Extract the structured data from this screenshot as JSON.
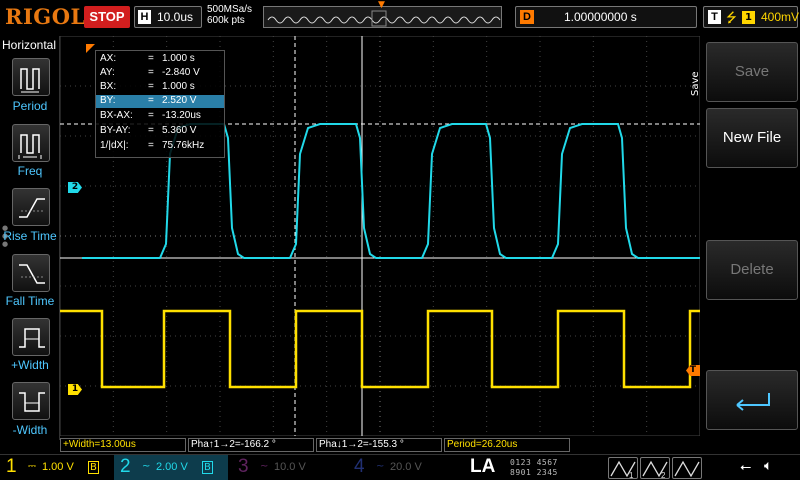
{
  "topbar": {
    "brand": "RIGOL",
    "run_state": "STOP",
    "timebase_tag": "H",
    "timebase": "10.0us",
    "sample_rate": "500MSa/s",
    "mem_depth": "600k pts",
    "delay_tag": "D",
    "delay": "1.00000000 s",
    "trigger_tag": "T",
    "trigger_source": "1",
    "trigger_level": "400mV"
  },
  "left_panel": {
    "title": "Horizontal",
    "items": [
      {
        "label": "Period",
        "icon": "period-icon"
      },
      {
        "label": "Freq",
        "icon": "frequency-icon"
      },
      {
        "label": "Rise Time",
        "icon": "rise-time-icon"
      },
      {
        "label": "Fall Time",
        "icon": "fall-time-icon"
      },
      {
        "label": "+Width",
        "icon": "positive-width-icon"
      },
      {
        "label": "-Width",
        "icon": "negative-width-icon"
      }
    ]
  },
  "cursor_readout": [
    {
      "key": "AX:",
      "value": "1.000 s"
    },
    {
      "key": "AY:",
      "value": "-2.840 V"
    },
    {
      "key": "BX:",
      "value": "1.000 s"
    },
    {
      "key": "BY:",
      "value": "2.520 V"
    },
    {
      "key": "BX-AX:",
      "value": "-13.20us"
    },
    {
      "key": "BY-AY:",
      "value": "5.360 V"
    },
    {
      "key": "1/|dX|:",
      "value": "75.76kHz"
    }
  ],
  "cursor_eq": "=",
  "markers": {
    "ch2": "2",
    "ch1": "1",
    "trigger": "T"
  },
  "right_panel": {
    "title": "Save",
    "save": "Save",
    "new_file": "New File",
    "delete": "Delete"
  },
  "measurements": {
    "pos_width": "+Width=13.00us",
    "phase_rise": "Pha↑1→2=-166.2 °",
    "phase_fall": "Pha↓1→2=-155.3 °",
    "period": "Period=26.20us"
  },
  "channels": [
    {
      "num": "1",
      "coupling": "⎓",
      "scale": "1.00 V",
      "bw": "B",
      "color": "#ffe000",
      "enabled": true
    },
    {
      "num": "2",
      "coupling": "~",
      "scale": "2.00 V",
      "bw": "B",
      "color": "#21d9e9",
      "enabled": true
    },
    {
      "num": "3",
      "coupling": "~",
      "scale": "10.0 V",
      "bw": "",
      "color": "#d14fd0",
      "enabled": false
    },
    {
      "num": "4",
      "coupling": "~",
      "scale": "20.0 V",
      "bw": "",
      "color": "#4a6cff",
      "enabled": false
    }
  ],
  "la": {
    "label": "LA",
    "row1": "0123 4567",
    "row2": "8901 2345"
  },
  "chart_data": {
    "type": "line",
    "x_unit": "us",
    "x": [
      -50,
      -40,
      -35,
      -30,
      -25,
      -20,
      -15,
      -10,
      -5,
      0,
      5,
      10,
      15,
      20,
      25,
      30,
      35,
      40,
      45,
      50
    ],
    "series": [
      {
        "name": "1",
        "color": "#ffe000",
        "volts_per_div": 1.0
      },
      {
        "name": "2",
        "color": "#21d9e9",
        "volts_per_div": 2.0
      }
    ],
    "cursors": {
      "AY_V": -2.84,
      "BY_V": 2.52,
      "dX_us": -13.2
    },
    "period_us": 26.2,
    "pos_width_us": 13.0,
    "grid": true
  }
}
